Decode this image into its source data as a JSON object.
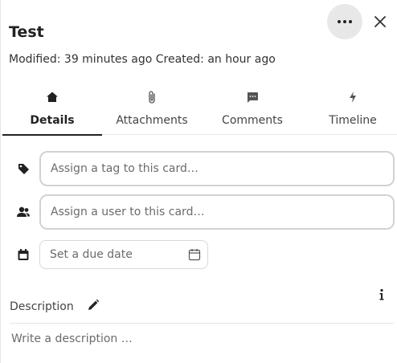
{
  "card": {
    "title": "Test",
    "meta": "Modified: 39 minutes ago Created: an hour ago"
  },
  "header": {
    "more_icon": "ellipsis-icon",
    "close_icon": "close-icon"
  },
  "tabs": [
    {
      "label": "Details",
      "icon": "home-icon",
      "active": true
    },
    {
      "label": "Attachments",
      "icon": "paperclip-icon",
      "active": false
    },
    {
      "label": "Comments",
      "icon": "comment-icon",
      "active": false
    },
    {
      "label": "Timeline",
      "icon": "lightning-icon",
      "active": false
    }
  ],
  "details": {
    "tag_placeholder": "Assign a tag to this card…",
    "user_placeholder": "Assign a user to this card…",
    "due_date_placeholder": "Set a due date"
  },
  "description": {
    "label": "Description",
    "placeholder": "Write a description …"
  }
}
